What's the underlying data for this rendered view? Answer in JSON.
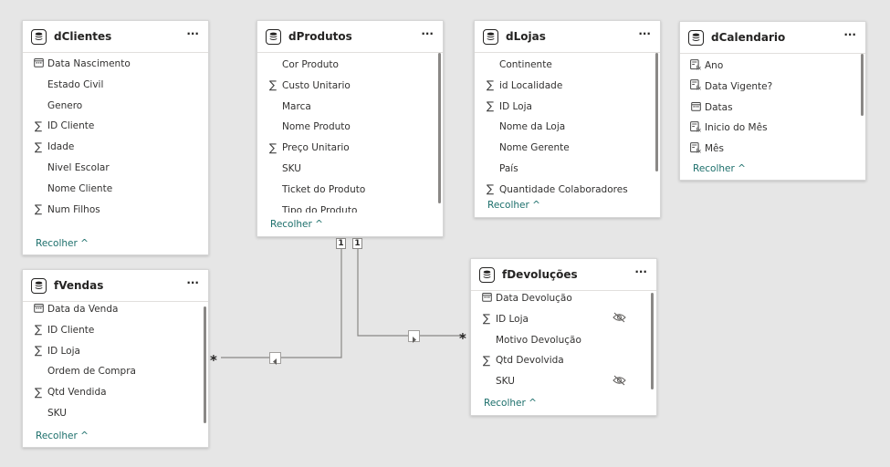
{
  "tables": {
    "dClientes": {
      "title": "dClientes",
      "more": "···",
      "fields": [
        {
          "icon": "calendar",
          "label": "Data Nascimento"
        },
        {
          "icon": "none",
          "label": "Estado Civil"
        },
        {
          "icon": "none",
          "label": "Genero"
        },
        {
          "icon": "sigma",
          "label": "ID Cliente"
        },
        {
          "icon": "sigma",
          "label": "Idade"
        },
        {
          "icon": "none",
          "label": "Nivel Escolar"
        },
        {
          "icon": "none",
          "label": "Nome Cliente"
        },
        {
          "icon": "sigma",
          "label": "Num Filhos"
        }
      ],
      "collapse": "Recolher ^"
    },
    "dProdutos": {
      "title": "dProdutos",
      "more": "···",
      "fields": [
        {
          "icon": "none",
          "label": "Cor Produto"
        },
        {
          "icon": "sigma",
          "label": "Custo Unitario"
        },
        {
          "icon": "none",
          "label": "Marca"
        },
        {
          "icon": "none",
          "label": "Nome Produto"
        },
        {
          "icon": "sigma",
          "label": "Preço Unitario"
        },
        {
          "icon": "none",
          "label": "SKU"
        },
        {
          "icon": "none",
          "label": "Ticket do Produto"
        },
        {
          "icon": "none",
          "label": "Tipo do Produto"
        }
      ],
      "collapse": "Recolher ^"
    },
    "dLojas": {
      "title": "dLojas",
      "more": "···",
      "fields": [
        {
          "icon": "none",
          "label": "Continente"
        },
        {
          "icon": "sigma",
          "label": "id Localidade"
        },
        {
          "icon": "sigma",
          "label": "ID Loja"
        },
        {
          "icon": "none",
          "label": "Nome da Loja"
        },
        {
          "icon": "none",
          "label": "Nome Gerente"
        },
        {
          "icon": "none",
          "label": "País"
        },
        {
          "icon": "sigma",
          "label": "Quantidade Colaboradores"
        }
      ],
      "collapse": "Recolher ^"
    },
    "dCalendario": {
      "title": "dCalendario",
      "more": "···",
      "fields": [
        {
          "icon": "calc",
          "label": "Ano"
        },
        {
          "icon": "calc",
          "label": "Data Vigente?"
        },
        {
          "icon": "calendar",
          "label": "Datas"
        },
        {
          "icon": "calc",
          "label": "Inicio do Mês"
        },
        {
          "icon": "calc",
          "label": "Mês"
        }
      ],
      "collapse": "Recolher ^"
    },
    "fVendas": {
      "title": "fVendas",
      "more": "···",
      "fields": [
        {
          "icon": "calendar",
          "label": "Data da Venda"
        },
        {
          "icon": "sigma",
          "label": "ID Cliente"
        },
        {
          "icon": "sigma",
          "label": "ID Loja"
        },
        {
          "icon": "none",
          "label": "Ordem de Compra"
        },
        {
          "icon": "sigma",
          "label": "Qtd Vendida"
        },
        {
          "icon": "none",
          "label": "SKU"
        }
      ],
      "collapse": "Recolher ^"
    },
    "fDevolucoes": {
      "title": "fDevoluções",
      "more": "···",
      "fields": [
        {
          "icon": "calendar",
          "label": "Data Devolução",
          "hidden": false
        },
        {
          "icon": "sigma",
          "label": "ID Loja",
          "hidden": true
        },
        {
          "icon": "none",
          "label": "Motivo Devolução",
          "hidden": false
        },
        {
          "icon": "sigma",
          "label": "Qtd Devolvida",
          "hidden": false
        },
        {
          "icon": "none",
          "label": "SKU",
          "hidden": true
        }
      ],
      "collapse": "Recolher ^"
    }
  },
  "relationships": {
    "one_label_left": "1",
    "one_label_right": "1",
    "many_label_vendas": "*",
    "many_label_devolucoes": "*"
  },
  "colors": {
    "background": "#e6e6e6",
    "link": "#1c6f6b",
    "line": "#8a8886"
  }
}
